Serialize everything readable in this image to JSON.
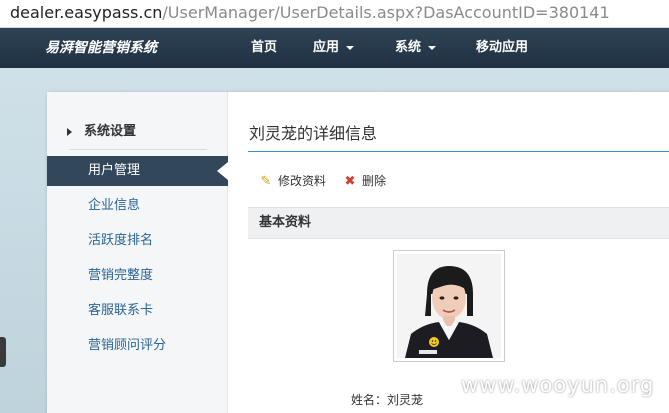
{
  "browser": {
    "url_domain": "dealer.easypass.cn",
    "url_path": "/UserManager/UserDetails.aspx?DasAccountID=380141"
  },
  "header": {
    "brand": "易湃智能营销系统",
    "nav": [
      {
        "label": "首页",
        "has_dropdown": false
      },
      {
        "label": "应用",
        "has_dropdown": true
      },
      {
        "label": "系统",
        "has_dropdown": true
      },
      {
        "label": "移动应用",
        "has_dropdown": false
      }
    ]
  },
  "sidebar": {
    "section_title": "系统设置",
    "items": [
      {
        "label": "用户管理",
        "active": true
      },
      {
        "label": "企业信息",
        "active": false
      },
      {
        "label": "活跃度排名",
        "active": false
      },
      {
        "label": "营销完整度",
        "active": false
      },
      {
        "label": "客服联系卡",
        "active": false
      },
      {
        "label": "营销顾问评分",
        "active": false
      }
    ]
  },
  "main": {
    "title": "刘灵茏的详细信息",
    "actions": {
      "edit_label": "修改资料",
      "delete_label": "删除"
    },
    "section_title": "基本资料",
    "profile": {
      "name_label": "姓名：",
      "name_value": "刘灵茏"
    }
  },
  "watermark": "www.wooyun.org",
  "colors": {
    "header_bg": "#2a3c4e",
    "active_item_bg": "#33475b",
    "link_blue": "#2a6496",
    "title_rule": "#3a8fc7"
  }
}
